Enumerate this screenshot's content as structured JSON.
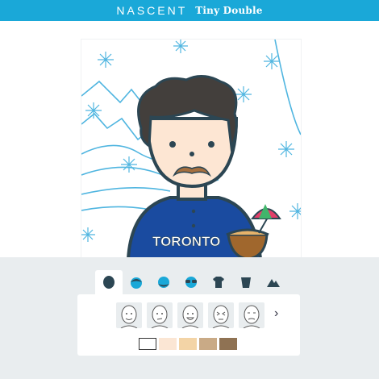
{
  "header": {
    "brand": "NASCENT",
    "app_title": "Tiny Double"
  },
  "avatar": {
    "jersey_text": "TORONTO"
  },
  "colors": {
    "topbar": "#1aa8d8",
    "panel": "#e9edef",
    "outline": "#2c4653",
    "hair": "#433f3c",
    "skin": "#fde6d3",
    "mustache": "#a56f3e",
    "jersey": "#1a4ba0",
    "snow": "#4fb5e0",
    "mountain": "#4fb5e0"
  },
  "tabs": [
    {
      "name": "skin-tab",
      "icon": "face-shape-icon"
    },
    {
      "name": "hair-tab",
      "icon": "hair-icon"
    },
    {
      "name": "facial-hair-tab",
      "icon": "beard-icon"
    },
    {
      "name": "glasses-tab",
      "icon": "glasses-icon"
    },
    {
      "name": "shirt-tab",
      "icon": "shirt-icon"
    },
    {
      "name": "accessory-tab",
      "icon": "cup-icon"
    },
    {
      "name": "background-tab",
      "icon": "mountain-icon"
    }
  ],
  "face_options": [
    "smile-face",
    "smirk-face",
    "grin-face",
    "wink-face",
    "flat-face"
  ],
  "skin_swatches": [
    "#ffffff",
    "#fbe6d4",
    "#f3d4a6",
    "#c9aa86",
    "#8f7253"
  ]
}
